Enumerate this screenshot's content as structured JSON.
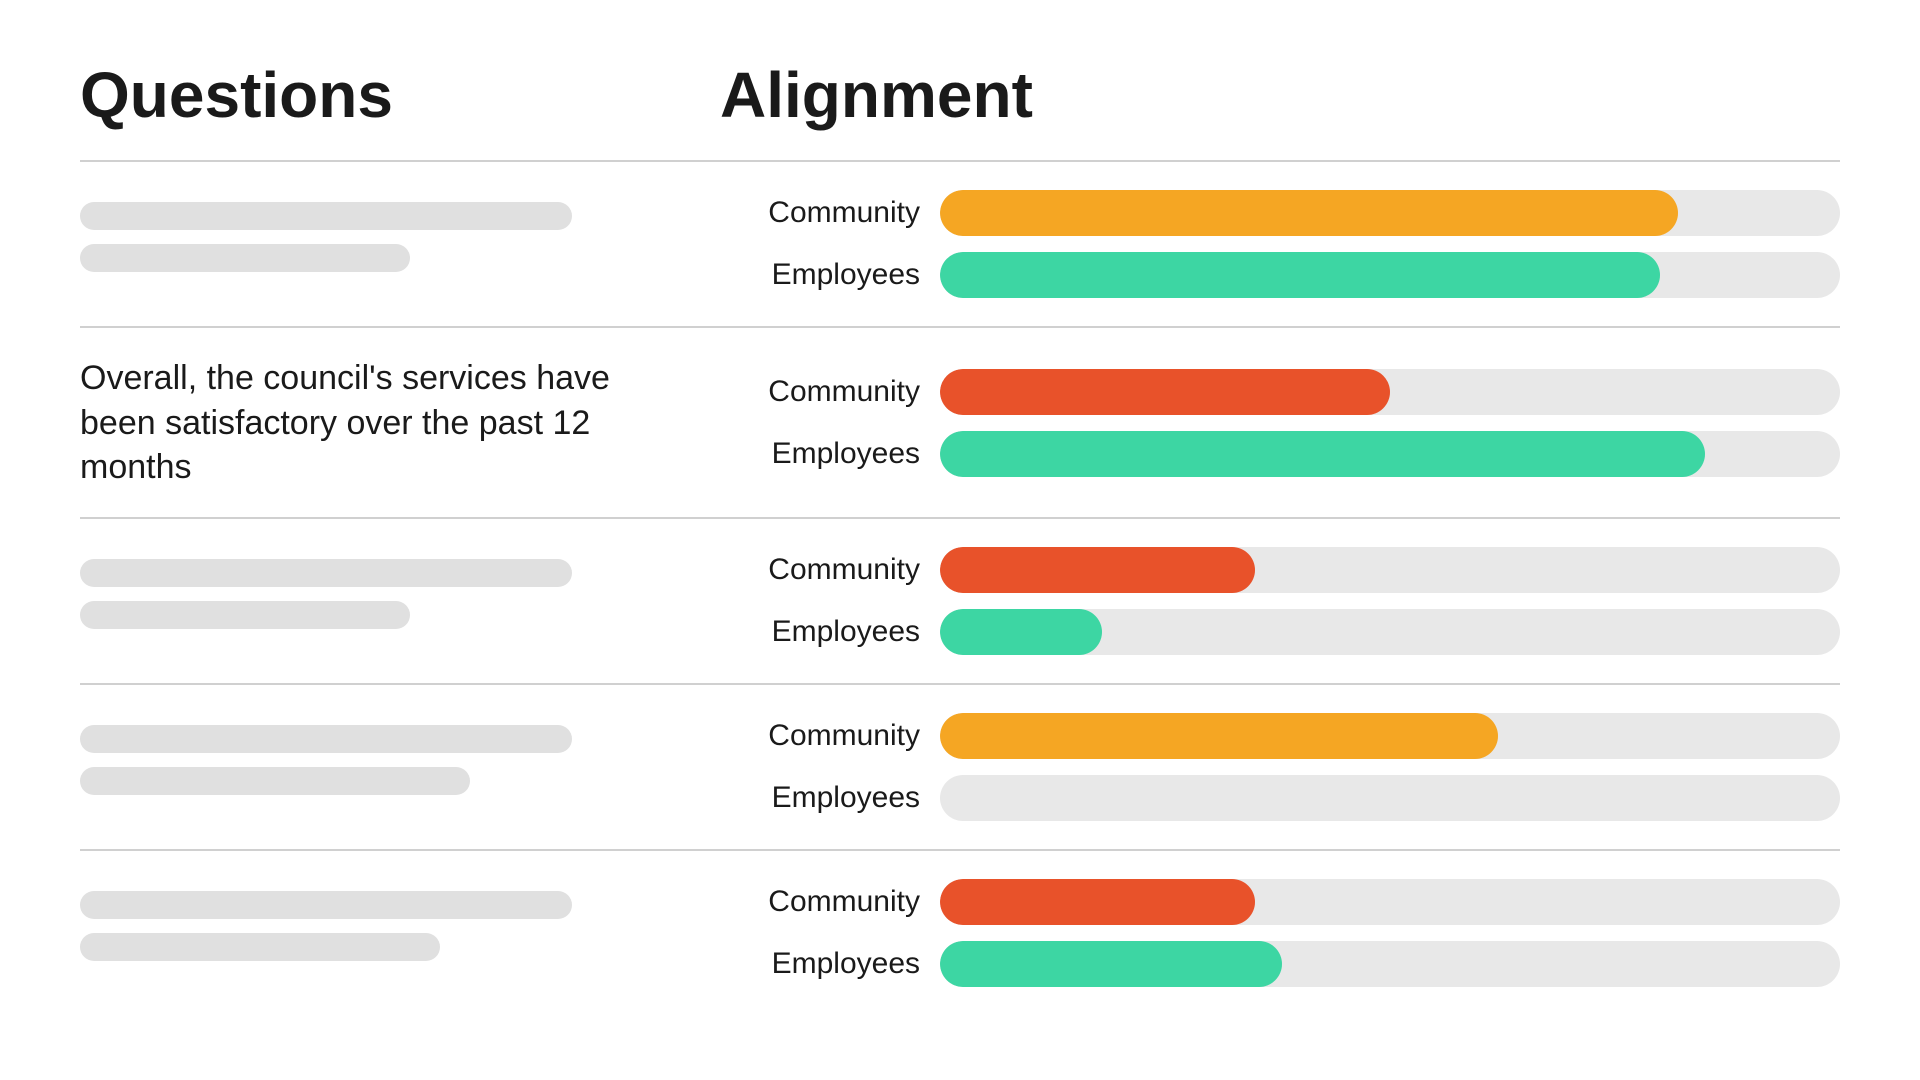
{
  "header": {
    "questions_title": "Questions",
    "alignment_title": "Alignment"
  },
  "rows": [
    {
      "id": "row1",
      "question_type": "placeholder",
      "placeholder_long_width": "82%",
      "placeholder_short_width": "55%",
      "bars": [
        {
          "label": "Community",
          "color": "bar-orange",
          "fill": "82%"
        },
        {
          "label": "Employees",
          "color": "bar-teal",
          "fill": "80%"
        }
      ]
    },
    {
      "id": "row2",
      "question_type": "text",
      "question_text": "Overall, the council's services have been satisfactory over the past 12 months",
      "bars": [
        {
          "label": "Community",
          "color": "bar-red-orange",
          "fill": "50%"
        },
        {
          "label": "Employees",
          "color": "bar-teal",
          "fill": "85%"
        }
      ]
    },
    {
      "id": "row3",
      "question_type": "placeholder",
      "placeholder_long_width": "82%",
      "placeholder_short_width": "55%",
      "bars": [
        {
          "label": "Community",
          "color": "bar-red-orange",
          "fill": "35%"
        },
        {
          "label": "Employees",
          "color": "bar-teal",
          "fill": "18%"
        }
      ]
    },
    {
      "id": "row4",
      "question_type": "placeholder",
      "placeholder_long_width": "82%",
      "placeholder_short_width": "65%",
      "bars": [
        {
          "label": "Community",
          "color": "bar-orange",
          "fill": "62%"
        },
        {
          "label": "Employees",
          "color": "bar-teal",
          "fill": "0%"
        }
      ]
    },
    {
      "id": "row5",
      "question_type": "placeholder",
      "placeholder_long_width": "82%",
      "placeholder_short_width": "60%",
      "bars": [
        {
          "label": "Community",
          "color": "bar-red-orange",
          "fill": "35%"
        },
        {
          "label": "Employees",
          "color": "bar-teal",
          "fill": "38%"
        }
      ]
    }
  ],
  "labels": {
    "community": "Community",
    "employees": "Employees"
  }
}
